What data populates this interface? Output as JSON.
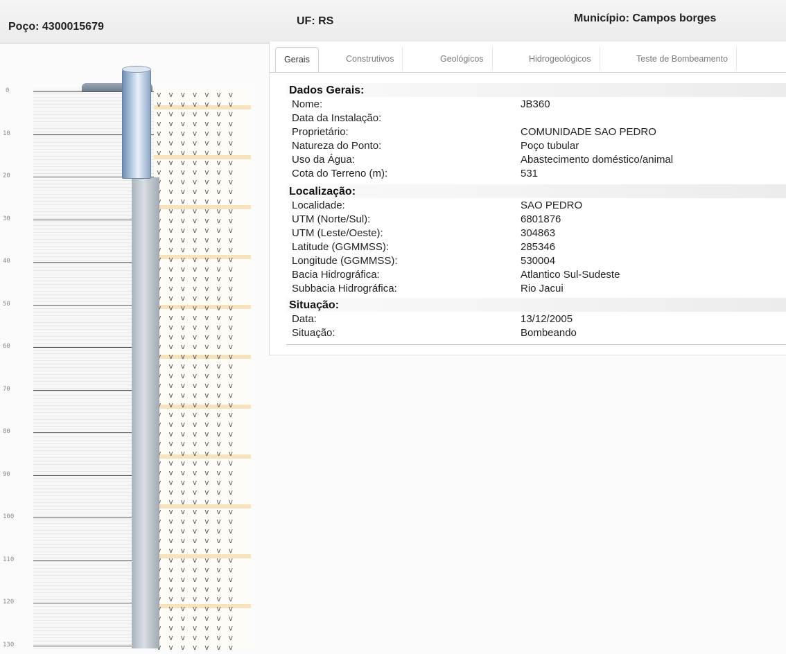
{
  "header": {
    "poco": "Poço: 4300015679",
    "uf": "UF: RS",
    "municipio": "Município: Campos borges"
  },
  "diagram": {
    "depth_ticks": [
      "0",
      "10",
      "20",
      "30",
      "40",
      "50",
      "60",
      "70",
      "80",
      "90",
      "100",
      "110",
      "120",
      "130"
    ]
  },
  "tabs": [
    "Gerais",
    "Construtivos",
    "Geológicos",
    "Hidrogeológicos",
    "Teste de Bombeamento"
  ],
  "active_tab": "Gerais",
  "dados_gerais": {
    "title": "Dados Gerais:",
    "rows": [
      {
        "k": "Nome:",
        "v": "JB360"
      },
      {
        "k": "Data da Instalação:",
        "v": ""
      },
      {
        "k": "Proprietário:",
        "v": "COMUNIDADE SAO PEDRO"
      },
      {
        "k": "Natureza do Ponto:",
        "v": "Poço tubular"
      },
      {
        "k": "Uso da Água:",
        "v": "Abastecimento doméstico/animal"
      },
      {
        "k": "Cota do Terreno (m):",
        "v": "531"
      }
    ]
  },
  "localizacao": {
    "title": "Localização:",
    "rows": [
      {
        "k": "Localidade:",
        "v": "SAO PEDRO"
      },
      {
        "k": "UTM (Norte/Sul):",
        "v": "6801876"
      },
      {
        "k": "UTM (Leste/Oeste):",
        "v": "304863"
      },
      {
        "k": "Latitude (GGMMSS):",
        "v": "285346"
      },
      {
        "k": "Longitude (GGMMSS):",
        "v": "530004"
      },
      {
        "k": "Bacia Hidrográfica:",
        "v": "Atlantico Sul-Sudeste"
      },
      {
        "k": "Subbacia Hidrográfica:",
        "v": "Rio Jacui"
      }
    ]
  },
  "situacao": {
    "title": "Situação:",
    "rows": [
      {
        "k": "Data:",
        "v": "13/12/2005"
      },
      {
        "k": "Situação:",
        "v": "Bombeando"
      }
    ]
  },
  "colors": {
    "casing": "#9fb8d6",
    "pipe": "#c2c9d0",
    "sediment": "#f0cd8c"
  }
}
